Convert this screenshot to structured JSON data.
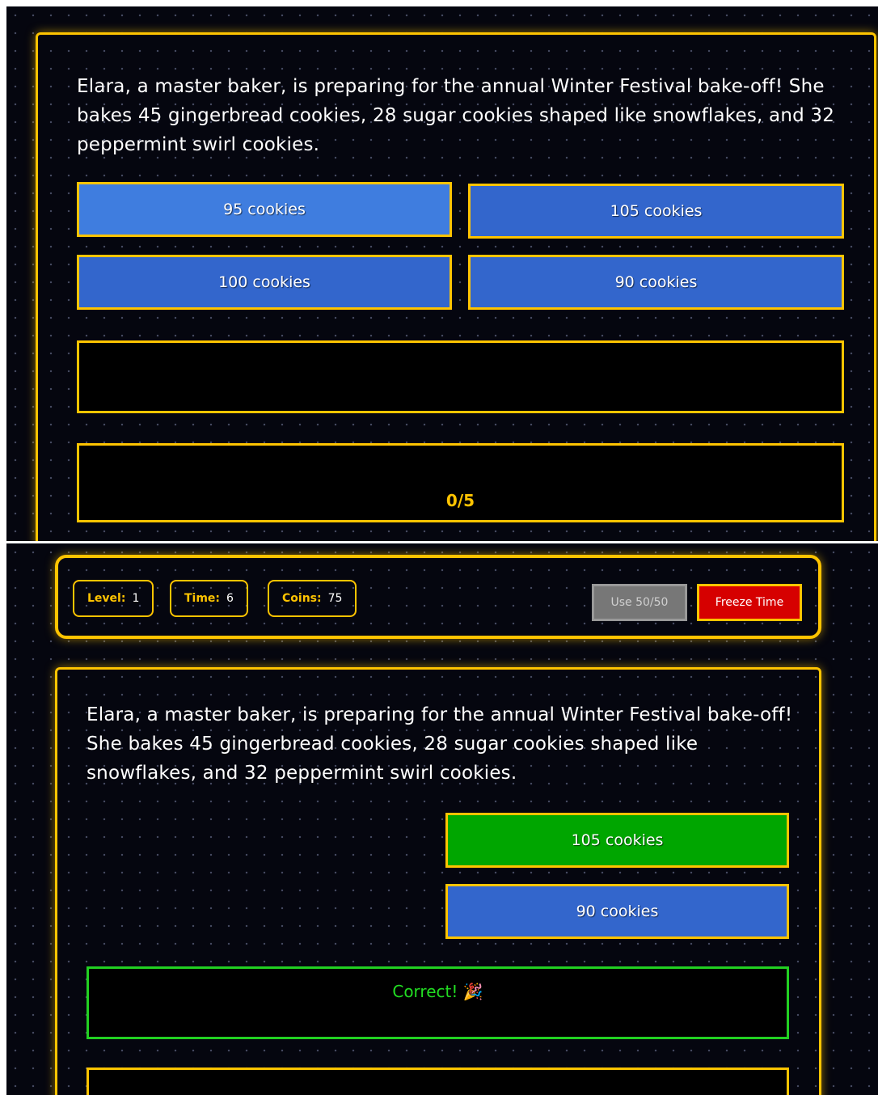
{
  "question": "Elara, a master baker, is preparing for the annual Winter Festival bake-off! She bakes 45 gingerbread cookies, 28 sugar cookies shaped like snowflakes, and 32 peppermint swirl cookies.",
  "top_screen": {
    "answers": [
      "95 cookies",
      "105 cookies",
      "100 cookies",
      "90 cookies"
    ],
    "feedback": "",
    "progress": "0/5"
  },
  "hud": {
    "level_label": "Level:",
    "level_value": "1",
    "time_label": "Time:",
    "time_value": "6",
    "coins_label": "Coins:",
    "coins_value": "75",
    "fifty_fifty_label": "Use 50/50",
    "freeze_label": "Freeze Time"
  },
  "bottom_screen": {
    "answers": [
      "105 cookies",
      "90 cookies"
    ],
    "feedback": "Correct! 🎉"
  },
  "colors": {
    "accent": "#ffc400",
    "answer_blue": "#3366cc",
    "correct_green": "#00a600",
    "freeze_red": "#d60000",
    "feedback_green": "#22dd22"
  }
}
